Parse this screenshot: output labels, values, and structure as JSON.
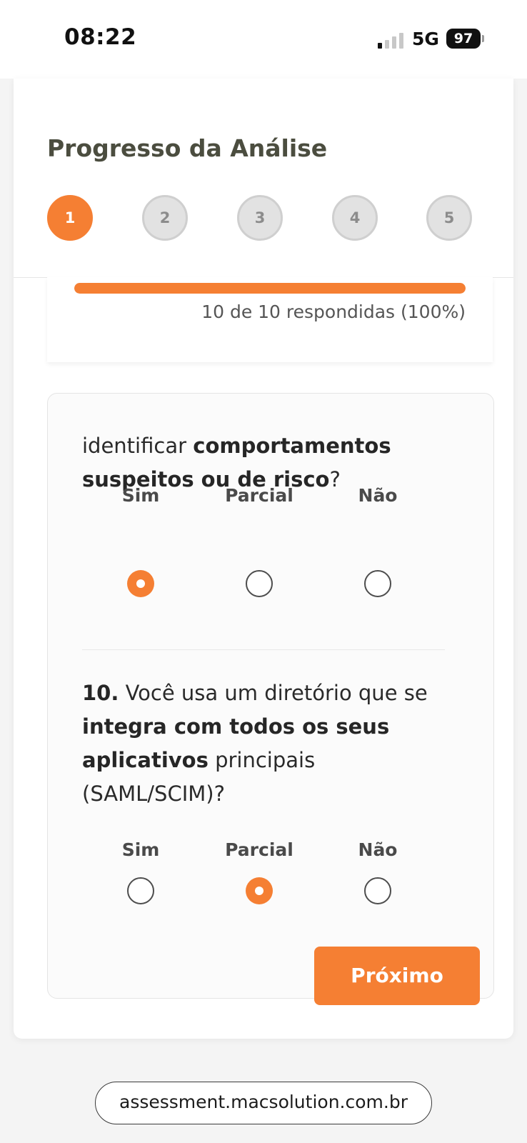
{
  "status": {
    "time": "08:22",
    "network": "5G",
    "battery": "97"
  },
  "header": {
    "title": "Progresso da Análise",
    "steps": [
      "1",
      "2",
      "3",
      "4",
      "5"
    ],
    "active_step": 1
  },
  "progress": {
    "fraction": 1.0,
    "text": "10 de 10 respondidas (100%)"
  },
  "questions": [
    {
      "text_plain_1": "identificar ",
      "text_bold_1": "comportamentos suspeitos ou de risco",
      "text_plain_2": "?",
      "options": [
        "Sim",
        "Parcial",
        "Não"
      ],
      "selected": "Sim"
    },
    {
      "number": "10.",
      "text_plain_1": " Você usa um diretório que se ",
      "text_bold_1": "integra com todos os seus aplicativos",
      "text_plain_2": " principais (SAML/SCIM)?",
      "options": [
        "Sim",
        "Parcial",
        "Não"
      ],
      "selected": "Parcial"
    }
  ],
  "buttons": {
    "next_label": "Próximo"
  },
  "browser": {
    "url": "assessment.macsolution.com.br"
  },
  "colors": {
    "accent": "#f57f33",
    "title": "#4b4d3f",
    "step_inactive": "#e2e2e2"
  }
}
